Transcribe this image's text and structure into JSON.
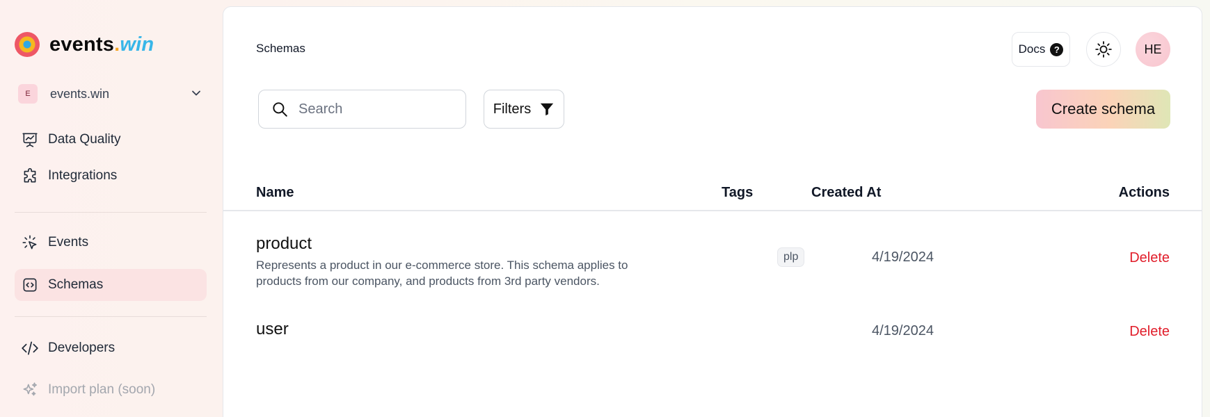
{
  "brand": {
    "name_main": "events",
    "name_dot": ".",
    "name_accent": "win"
  },
  "workspace": {
    "badge": "E",
    "name": "events.win"
  },
  "sidebar": {
    "items": [
      {
        "label": "Data Quality",
        "icon": "presentation-chart-icon"
      },
      {
        "label": "Integrations",
        "icon": "puzzle-icon"
      },
      {
        "label": "Events",
        "icon": "cursor-click-icon"
      },
      {
        "label": "Schemas",
        "icon": "code-bracket-square-icon",
        "active": true
      },
      {
        "label": "Developers",
        "icon": "code-bracket-icon"
      },
      {
        "label": "Import plan (soon)",
        "icon": "sparkles-icon",
        "disabled": true
      }
    ]
  },
  "header": {
    "title": "Schemas",
    "docs_label": "Docs",
    "docs_icon": "?",
    "avatar_initials": "HE"
  },
  "toolbar": {
    "search_placeholder": "Search",
    "filters_label": "Filters",
    "create_label": "Create schema"
  },
  "table": {
    "columns": [
      "Name",
      "Tags",
      "Created At",
      "Actions"
    ],
    "rows": [
      {
        "name": "product",
        "description_line1": "Represents a product in our e-commerce store. This schema applies to",
        "description_line2": "products from our company, and products from 3rd party vendors.",
        "tag": "plp",
        "created_at": "4/19/2024",
        "action": "Delete"
      },
      {
        "name": "user",
        "tag": "",
        "created_at": "4/19/2024",
        "action": "Delete"
      }
    ]
  },
  "colors": {
    "active_nav": "#fbe3e3",
    "delete": "#e11d2a",
    "accent_blue": "#38b6e8"
  }
}
